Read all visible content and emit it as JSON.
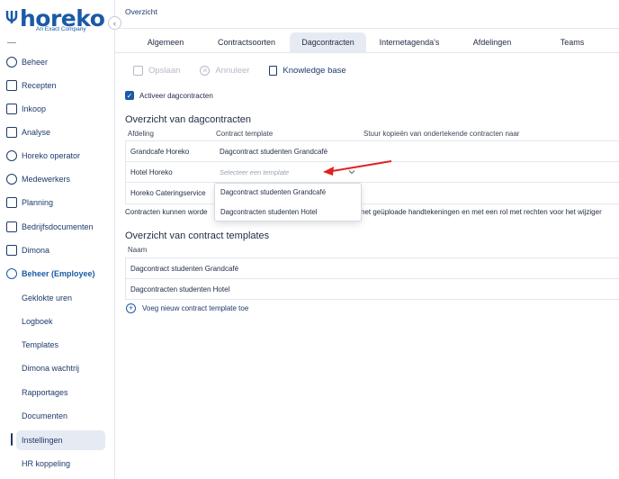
{
  "brand": {
    "name": "horeko",
    "tagline": "An Exact Company",
    "accent": "#1b5aa5"
  },
  "sidebar": {
    "items": [
      {
        "label": "Beheer",
        "icon": "person-gear-icon"
      },
      {
        "label": "Recepten",
        "icon": "house-icon"
      },
      {
        "label": "Inkoop",
        "icon": "cart-icon"
      },
      {
        "label": "Analyse",
        "icon": "chart-icon"
      },
      {
        "label": "Horeko operator",
        "icon": "operator-icon"
      },
      {
        "label": "Medewerkers",
        "icon": "people-icon"
      },
      {
        "label": "Planning",
        "icon": "calendar-icon"
      },
      {
        "label": "Bedrijfsdocumenten",
        "icon": "folder-icon"
      },
      {
        "label": "Dimona",
        "icon": "id-card-icon"
      },
      {
        "label": "Beheer (Employee)",
        "icon": "person-gear-icon"
      }
    ],
    "subitems": [
      {
        "label": "Geklokte uren"
      },
      {
        "label": "Logboek"
      },
      {
        "label": "Templates"
      },
      {
        "label": "Dimona wachtrij"
      },
      {
        "label": "Rapportages"
      },
      {
        "label": "Documenten"
      },
      {
        "label": "Instellingen"
      },
      {
        "label": "HR koppeling"
      }
    ]
  },
  "header": {
    "breadcrumb": "Overzicht"
  },
  "tabs": [
    {
      "label": "Algemeen"
    },
    {
      "label": "Contractsoorten"
    },
    {
      "label": "Dagcontracten"
    },
    {
      "label": "Internetagenda's"
    },
    {
      "label": "Afdelingen"
    },
    {
      "label": "Teams"
    }
  ],
  "toolbar": {
    "save": "Opslaan",
    "cancel": "Annuleer",
    "kb": "Knowledge base"
  },
  "activate": {
    "label": "Activeer dagcontracten",
    "checked": true
  },
  "dagcontracten": {
    "title": "Overzicht van dagcontracten",
    "headers": {
      "afdeling": "Afdeling",
      "template": "Contract template",
      "copies": "Stuur kopieën van ondertekende contracten naar"
    },
    "rows": [
      {
        "afdeling": "Grandcafe Horeko",
        "template": "Dagcontract studenten Grandcafé"
      },
      {
        "afdeling": "Hotel Horeko",
        "template": ""
      },
      {
        "afdeling": "Horeko Cateringservice",
        "template": ""
      }
    ],
    "placeholder": "Selecteer een template",
    "dropdown": [
      "Dagcontract studenten Grandcafé",
      "Dagcontracten studenten Hotel"
    ],
    "note_left": "Contracten kunnen worde",
    "note_right": "net geüploade handtekeningen en met een rol met rechten voor het wijziger"
  },
  "templates": {
    "title": "Overzicht van contract templates",
    "header": "Naam",
    "rows": [
      "Dagcontract studenten Grandcafé",
      "Dagcontracten studenten Hotel"
    ],
    "add": "Voeg nieuw contract template toe"
  }
}
